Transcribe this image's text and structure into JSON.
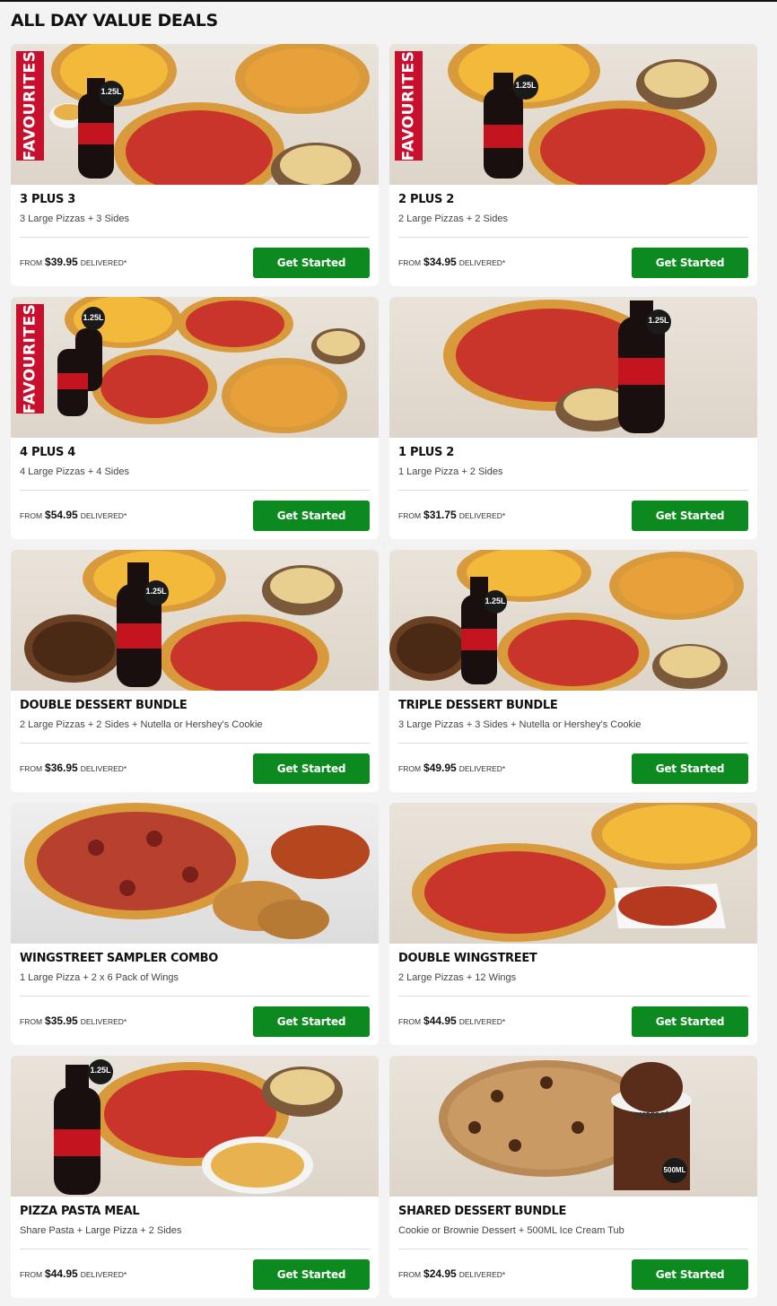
{
  "section": {
    "title": "ALL DAY VALUE DEALS"
  },
  "colors": {
    "button": "#0d8a1f",
    "ribbon": "#c8102e"
  },
  "deals": [
    {
      "title": "3 PLUS 3",
      "desc": "3 Large Pizzas + 3 Sides",
      "from": "FROM",
      "price": "$39.95",
      "delivered": "DELIVERED*",
      "cta": "Get Started",
      "ribbon": "FAVOURITES",
      "bottle_label": "1.25L"
    },
    {
      "title": "2 PLUS 2",
      "desc": "2 Large Pizzas + 2 Sides",
      "from": "FROM",
      "price": "$34.95",
      "delivered": "DELIVERED*",
      "cta": "Get Started",
      "ribbon": "FAVOURITES",
      "bottle_label": "1.25L"
    },
    {
      "title": "4 PLUS 4",
      "desc": "4 Large Pizzas + 4 Sides",
      "from": "FROM",
      "price": "$54.95",
      "delivered": "DELIVERED*",
      "cta": "Get Started",
      "ribbon": "FAVOURITES",
      "bottle_label": "1.25L"
    },
    {
      "title": "1 PLUS 2",
      "desc": "1 Large Pizza + 2 Sides",
      "from": "FROM",
      "price": "$31.75",
      "delivered": "DELIVERED*",
      "cta": "Get Started",
      "bottle_label": "1.25L"
    },
    {
      "title": "DOUBLE DESSERT BUNDLE",
      "desc": "2 Large Pizzas + 2 Sides + Nutella or Hershey's Cookie",
      "from": "FROM",
      "price": "$36.95",
      "delivered": "DELIVERED*",
      "cta": "Get Started",
      "bottle_label": "1.25L"
    },
    {
      "title": "TRIPLE DESSERT BUNDLE",
      "desc": "3 Large Pizzas + 3 Sides + Nutella or Hershey's Cookie",
      "from": "FROM",
      "price": "$49.95",
      "delivered": "DELIVERED*",
      "cta": "Get Started",
      "bottle_label": "1.25L"
    },
    {
      "title": "WINGSTREET SAMPLER COMBO",
      "desc": "1 Large Pizza + 2 x 6 Pack of Wings",
      "from": "FROM",
      "price": "$35.95",
      "delivered": "DELIVERED*",
      "cta": "Get Started"
    },
    {
      "title": "DOUBLE WINGSTREET",
      "desc": "2 Large Pizzas + 12 Wings",
      "from": "FROM",
      "price": "$44.95",
      "delivered": "DELIVERED*",
      "cta": "Get Started"
    },
    {
      "title": "PIZZA PASTA MEAL",
      "desc": "Share Pasta + Large Pizza + 2 Sides",
      "from": "FROM",
      "price": "$44.95",
      "delivered": "DELIVERED*",
      "cta": "Get Started",
      "bottle_label": "1.25L"
    },
    {
      "title": "SHARED DESSERT BUNDLE",
      "desc": "Cookie or Brownie Dessert + 500ML Ice Cream Tub",
      "from": "FROM",
      "price": "$24.95",
      "delivered": "DELIVERED*",
      "cta": "Get Started",
      "tub_brand": "everest",
      "tub_label": "500ML"
    }
  ]
}
